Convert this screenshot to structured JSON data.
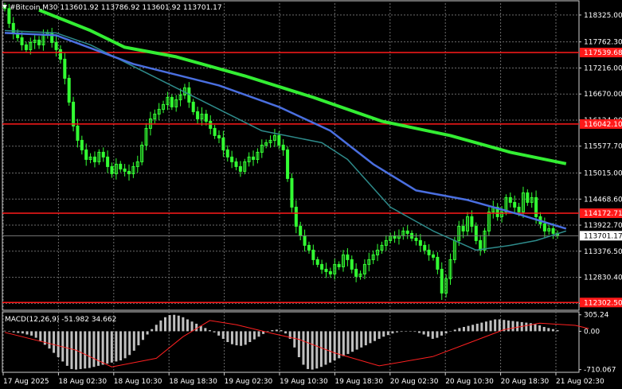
{
  "header": {
    "icon": "down-arrow-icon",
    "text": "#Bitcoin,M30  113601.92 113786.92 113601.92 113701.17"
  },
  "colors": {
    "background": "#000000",
    "grid": "#6b6b6b",
    "candles": "#33ff33",
    "ma_fast": "#2e8b8b",
    "ma_mid": "#4a6fe0",
    "ma_slow": "#33ee33",
    "level": "#ff1a1a",
    "macd_hist": "#c0c0c0",
    "macd_signal": "#ff2020",
    "current": "#7a7a7a"
  },
  "chart_data": [
    {
      "type": "candlestick",
      "symbol": "#Bitcoin",
      "timeframe": "M30",
      "ohlc_last": {
        "open": 113601.92,
        "high": 113786.92,
        "low": 113601.92,
        "close": 113701.17
      },
      "y_ticks": [
        "118325.00",
        "117762.30",
        "117216.00",
        "116670.00",
        "116124.00",
        "115577.70",
        "115015.00",
        "114468.60",
        "113922.70",
        "113376.50",
        "112830.40",
        "112284.30"
      ],
      "ylim": [
        112140,
        118640
      ],
      "x_ticks": [
        "17 Aug 2025",
        "18 Aug 02:30",
        "18 Aug 10:30",
        "18 Aug 18:30",
        "19 Aug 02:30",
        "19 Aug 10:30",
        "19 Aug 18:30",
        "20 Aug 02:30",
        "20 Aug 10:30",
        "20 Aug 18:30",
        "21 Aug 02:30"
      ],
      "levels": [
        {
          "value": 117539.68,
          "label": "117539.68"
        },
        {
          "value": 116042.1,
          "label": "116042.10"
        },
        {
          "value": 114172.71,
          "label": "114172.71"
        },
        {
          "value": 112302.5,
          "label": "112302.50"
        }
      ],
      "current_price": {
        "value": 113701.17,
        "label": "113701.17"
      },
      "close_path": [
        118460,
        118150,
        117950,
        117850,
        117700,
        117600,
        117750,
        117800,
        117700,
        117900,
        117950,
        117750,
        117600,
        117400,
        117000,
        116500,
        116000,
        115700,
        115500,
        115300,
        115350,
        115250,
        115450,
        115350,
        115150,
        115000,
        115200,
        115100,
        115050,
        115000,
        115150,
        115250,
        115600,
        115950,
        116150,
        116250,
        116350,
        116450,
        116600,
        116400,
        116550,
        116650,
        116800,
        116500,
        116300,
        116150,
        116250,
        116100,
        115950,
        115800,
        115750,
        115500,
        115350,
        115250,
        115150,
        115050,
        115250,
        115350,
        115300,
        115450,
        115600,
        115650,
        115700,
        115800,
        115600,
        115500,
        114900,
        114300,
        113900,
        113700,
        113500,
        113400,
        113200,
        113100,
        113000,
        112950,
        112900,
        113100,
        113050,
        113300,
        113200,
        113000,
        112850,
        112900,
        113100,
        113200,
        113300,
        113400,
        113500,
        113600,
        113700,
        113650,
        113700,
        113800,
        113750,
        113650,
        113600,
        113500,
        113400,
        113300,
        113250,
        113000,
        112500,
        112800,
        113200,
        113600,
        113900,
        113800,
        114100,
        113900,
        113600,
        113400,
        113800,
        114200,
        114300,
        114100,
        114200,
        114500,
        114400,
        114300,
        114200,
        114600,
        114400,
        114500,
        114100,
        113950,
        113800,
        113850,
        113750,
        113701
      ],
      "series": [
        {
          "key": "ma_fast",
          "points": [
            [
              0,
              118000
            ],
            [
              12,
              117950
            ],
            [
              20,
              117700
            ],
            [
              40,
              116800
            ],
            [
              60,
              115900
            ],
            [
              74,
              115650
            ],
            [
              80,
              115300
            ],
            [
              90,
              114300
            ],
            [
              100,
              113800
            ],
            [
              110,
              113400
            ],
            [
              118,
              113500
            ],
            [
              124,
              113600
            ],
            [
              131,
              113800
            ]
          ]
        },
        {
          "key": "ma_mid",
          "points": [
            [
              0,
              117950
            ],
            [
              12,
              117900
            ],
            [
              30,
              117300
            ],
            [
              50,
              116850
            ],
            [
              64,
              116400
            ],
            [
              76,
              115900
            ],
            [
              86,
              115200
            ],
            [
              96,
              114650
            ],
            [
              108,
              114450
            ],
            [
              120,
              114150
            ],
            [
              131,
              113850
            ]
          ]
        },
        {
          "key": "ma_slow",
          "points": [
            [
              8,
              118430
            ],
            [
              20,
              118000
            ],
            [
              28,
              117650
            ],
            [
              40,
              117450
            ],
            [
              56,
              117050
            ],
            [
              72,
              116600
            ],
            [
              88,
              116100
            ],
            [
              104,
              115800
            ],
            [
              118,
              115450
            ],
            [
              131,
              115210
            ]
          ]
        }
      ]
    },
    {
      "type": "bar",
      "title": "MACD(12,26,9) -51.982 34.662",
      "y_ticks": [
        "305.24",
        "0.00",
        "-710.067"
      ],
      "ylim": [
        -760,
        360
      ],
      "histogram": [
        10,
        -5,
        -20,
        -30,
        -40,
        -60,
        -80,
        -120,
        -180,
        -250,
        -320,
        -400,
        -480,
        -560,
        -640,
        -700,
        -710,
        -700,
        -690,
        -680,
        -660,
        -640,
        -620,
        -600,
        -580,
        -560,
        -540,
        -500,
        -440,
        -360,
        -260,
        -160,
        -60,
        40,
        120,
        200,
        260,
        300,
        305,
        290,
        260,
        220,
        180,
        140,
        100,
        60,
        20,
        -20,
        -80,
        -140,
        -200,
        -240,
        -260,
        -270,
        -250,
        -200,
        -150,
        -100,
        -50,
        0,
        20,
        30,
        20,
        -40,
        -140,
        -300,
        -480,
        -620,
        -700,
        -710,
        -690,
        -660,
        -620,
        -580,
        -540,
        -500,
        -460,
        -420,
        -380,
        -340,
        -300,
        -260,
        -220,
        -180,
        -140,
        -100,
        -70,
        -40,
        -20,
        -10,
        -5,
        0,
        -10,
        -30,
        -60,
        -100,
        -140,
        -120,
        -80,
        -40,
        0,
        30,
        60,
        80,
        100,
        120,
        140,
        160,
        180,
        200,
        220,
        220,
        210,
        200,
        190,
        180,
        170,
        160,
        150,
        130,
        110,
        80,
        60,
        40,
        20
      ],
      "signal_points": [
        [
          0,
          -20
        ],
        [
          16,
          -350
        ],
        [
          24,
          -660
        ],
        [
          34,
          -500
        ],
        [
          40,
          -100
        ],
        [
          46,
          200
        ],
        [
          52,
          120
        ],
        [
          60,
          -40
        ],
        [
          66,
          -150
        ],
        [
          74,
          -400
        ],
        [
          84,
          -640
        ],
        [
          96,
          -470
        ],
        [
          104,
          -220
        ],
        [
          112,
          30
        ],
        [
          120,
          150
        ],
        [
          128,
          110
        ],
        [
          131,
          50
        ]
      ]
    }
  ]
}
